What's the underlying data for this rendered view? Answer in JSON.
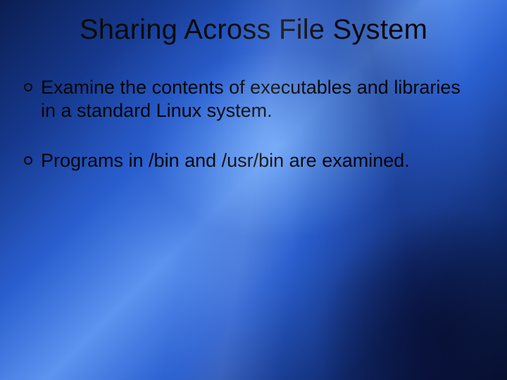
{
  "title": "Sharing Across File System",
  "bullets": [
    {
      "text": "Examine the contents of executables and libraries in a standard Linux system."
    },
    {
      "text": "Programs in /bin and /usr/bin are examined."
    }
  ]
}
